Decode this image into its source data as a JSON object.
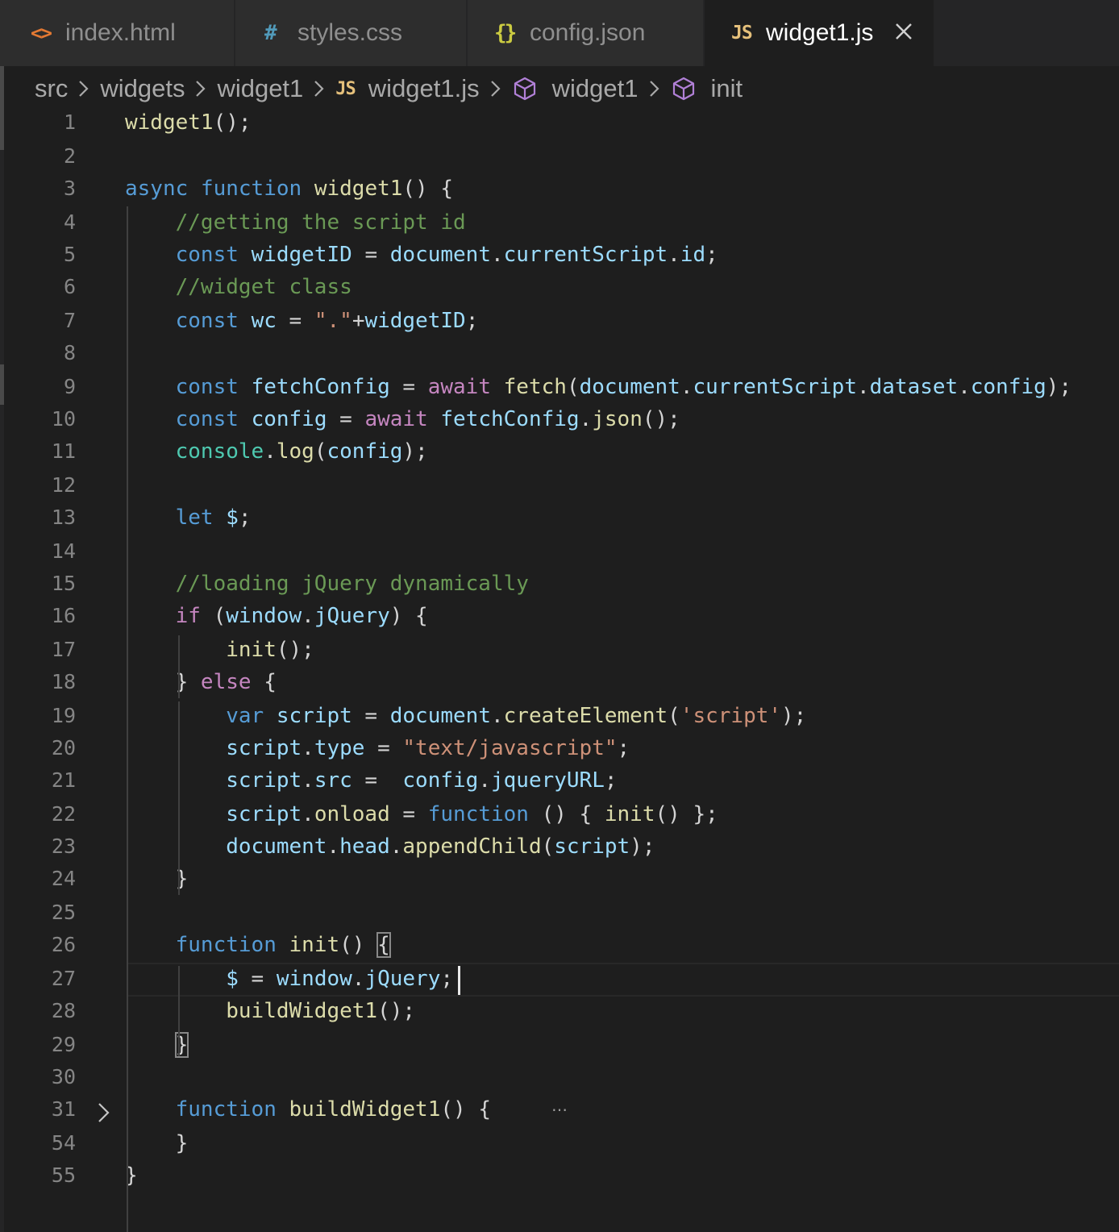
{
  "tabs": [
    {
      "icon": "<>",
      "label": "index.html",
      "active": false
    },
    {
      "icon": "#",
      "label": "styles.css",
      "active": false
    },
    {
      "icon": "{}",
      "label": "config.json",
      "active": false
    },
    {
      "icon": "JS",
      "label": "widget1.js",
      "active": true
    }
  ],
  "breadcrumb": {
    "items": [
      "src",
      "widgets",
      "widget1",
      "widget1.js",
      "widget1",
      "init"
    ],
    "file_icon": "JS"
  },
  "icons": {
    "html": "html-brackets-icon",
    "css": "css-hash-icon",
    "json": "json-braces-icon",
    "js": "javascript-icon",
    "close": "close-icon",
    "chevron": "chevron-right-icon",
    "symbol": "cube-symbol-icon",
    "fold": "fold-chevron-icon"
  },
  "colors": {
    "background": "#1e1e1e",
    "tab_inactive": "#2d2d2d",
    "keyword": "#569cd6",
    "control": "#c586c0",
    "function": "#dcdcaa",
    "variable": "#9cdcfe",
    "string": "#ce9178",
    "comment": "#6a9955",
    "class": "#4ec9b0",
    "line_number": "#858585",
    "html_icon": "#e37933",
    "css_icon": "#519aba",
    "json_icon": "#cbcb41",
    "js_icon": "#e5c07b",
    "symbol_icon": "#b180d7"
  },
  "editor": {
    "lines": [
      {
        "n": "1",
        "tokens": [
          [
            "fn",
            "widget1"
          ],
          [
            "pun",
            "();"
          ]
        ]
      },
      {
        "n": "2",
        "tokens": []
      },
      {
        "n": "3",
        "tokens": [
          [
            "kw",
            "async"
          ],
          [
            "pun",
            " "
          ],
          [
            "kw",
            "function"
          ],
          [
            "pun",
            " "
          ],
          [
            "fn",
            "widget1"
          ],
          [
            "pun",
            "() {"
          ]
        ]
      },
      {
        "n": "4",
        "tokens": [
          [
            "pun",
            "    "
          ],
          [
            "cmt",
            "//getting the script id"
          ]
        ]
      },
      {
        "n": "5",
        "tokens": [
          [
            "pun",
            "    "
          ],
          [
            "kw",
            "const"
          ],
          [
            "pun",
            " "
          ],
          [
            "var",
            "widgetID"
          ],
          [
            "pun",
            " = "
          ],
          [
            "var",
            "document"
          ],
          [
            "pun",
            "."
          ],
          [
            "var",
            "currentScript"
          ],
          [
            "pun",
            "."
          ],
          [
            "var",
            "id"
          ],
          [
            "pun",
            ";"
          ]
        ]
      },
      {
        "n": "6",
        "tokens": [
          [
            "pun",
            "    "
          ],
          [
            "cmt",
            "//widget class"
          ]
        ]
      },
      {
        "n": "7",
        "tokens": [
          [
            "pun",
            "    "
          ],
          [
            "kw",
            "const"
          ],
          [
            "pun",
            " "
          ],
          [
            "var",
            "wc"
          ],
          [
            "pun",
            " = "
          ],
          [
            "str",
            "\".\""
          ],
          [
            "pun",
            "+"
          ],
          [
            "var",
            "widgetID"
          ],
          [
            "pun",
            ";"
          ]
        ]
      },
      {
        "n": "8",
        "tokens": []
      },
      {
        "n": "9",
        "tokens": [
          [
            "pun",
            "    "
          ],
          [
            "kw",
            "const"
          ],
          [
            "pun",
            " "
          ],
          [
            "var",
            "fetchConfig"
          ],
          [
            "pun",
            " = "
          ],
          [
            "ctl",
            "await"
          ],
          [
            "pun",
            " "
          ],
          [
            "fn",
            "fetch"
          ],
          [
            "pun",
            "("
          ],
          [
            "var",
            "document"
          ],
          [
            "pun",
            "."
          ],
          [
            "var",
            "currentScript"
          ],
          [
            "pun",
            "."
          ],
          [
            "var",
            "dataset"
          ],
          [
            "pun",
            "."
          ],
          [
            "var",
            "config"
          ],
          [
            "pun",
            ");"
          ]
        ]
      },
      {
        "n": "10",
        "tokens": [
          [
            "pun",
            "    "
          ],
          [
            "kw",
            "const"
          ],
          [
            "pun",
            " "
          ],
          [
            "var",
            "config"
          ],
          [
            "pun",
            " = "
          ],
          [
            "ctl",
            "await"
          ],
          [
            "pun",
            " "
          ],
          [
            "var",
            "fetchConfig"
          ],
          [
            "pun",
            "."
          ],
          [
            "fn",
            "json"
          ],
          [
            "pun",
            "();"
          ]
        ]
      },
      {
        "n": "11",
        "tokens": [
          [
            "pun",
            "    "
          ],
          [
            "cls",
            "console"
          ],
          [
            "pun",
            "."
          ],
          [
            "fn",
            "log"
          ],
          [
            "pun",
            "("
          ],
          [
            "var",
            "config"
          ],
          [
            "pun",
            ");"
          ]
        ]
      },
      {
        "n": "12",
        "tokens": []
      },
      {
        "n": "13",
        "tokens": [
          [
            "pun",
            "    "
          ],
          [
            "kw",
            "let"
          ],
          [
            "pun",
            " "
          ],
          [
            "var",
            "$"
          ],
          [
            "pun",
            ";"
          ]
        ]
      },
      {
        "n": "14",
        "tokens": []
      },
      {
        "n": "15",
        "tokens": [
          [
            "pun",
            "    "
          ],
          [
            "cmt",
            "//loading jQuery dynamically"
          ]
        ]
      },
      {
        "n": "16",
        "tokens": [
          [
            "pun",
            "    "
          ],
          [
            "ctl",
            "if"
          ],
          [
            "pun",
            " ("
          ],
          [
            "var",
            "window"
          ],
          [
            "pun",
            "."
          ],
          [
            "var",
            "jQuery"
          ],
          [
            "pun",
            ") {"
          ]
        ]
      },
      {
        "n": "17",
        "tokens": [
          [
            "pun",
            "        "
          ],
          [
            "fn",
            "init"
          ],
          [
            "pun",
            "();"
          ]
        ]
      },
      {
        "n": "18",
        "tokens": [
          [
            "pun",
            "    } "
          ],
          [
            "ctl",
            "else"
          ],
          [
            "pun",
            " {"
          ]
        ]
      },
      {
        "n": "19",
        "tokens": [
          [
            "pun",
            "        "
          ],
          [
            "kw",
            "var"
          ],
          [
            "pun",
            " "
          ],
          [
            "var",
            "script"
          ],
          [
            "pun",
            " = "
          ],
          [
            "var",
            "document"
          ],
          [
            "pun",
            "."
          ],
          [
            "fn",
            "createElement"
          ],
          [
            "pun",
            "("
          ],
          [
            "str",
            "'script'"
          ],
          [
            "pun",
            ");"
          ]
        ]
      },
      {
        "n": "20",
        "tokens": [
          [
            "pun",
            "        "
          ],
          [
            "var",
            "script"
          ],
          [
            "pun",
            "."
          ],
          [
            "var",
            "type"
          ],
          [
            "pun",
            " = "
          ],
          [
            "str",
            "\"text/javascript\""
          ],
          [
            "pun",
            ";"
          ]
        ]
      },
      {
        "n": "21",
        "tokens": [
          [
            "pun",
            "        "
          ],
          [
            "var",
            "script"
          ],
          [
            "pun",
            "."
          ],
          [
            "var",
            "src"
          ],
          [
            "pun",
            " =  "
          ],
          [
            "var",
            "config"
          ],
          [
            "pun",
            "."
          ],
          [
            "var",
            "jqueryURL"
          ],
          [
            "pun",
            ";"
          ]
        ]
      },
      {
        "n": "22",
        "tokens": [
          [
            "pun",
            "        "
          ],
          [
            "var",
            "script"
          ],
          [
            "pun",
            "."
          ],
          [
            "fn",
            "onload"
          ],
          [
            "pun",
            " = "
          ],
          [
            "kw",
            "function"
          ],
          [
            "pun",
            " () { "
          ],
          [
            "fn",
            "init"
          ],
          [
            "pun",
            "() };"
          ]
        ]
      },
      {
        "n": "23",
        "tokens": [
          [
            "pun",
            "        "
          ],
          [
            "var",
            "document"
          ],
          [
            "pun",
            "."
          ],
          [
            "var",
            "head"
          ],
          [
            "pun",
            "."
          ],
          [
            "fn",
            "appendChild"
          ],
          [
            "pun",
            "("
          ],
          [
            "var",
            "script"
          ],
          [
            "pun",
            ");"
          ]
        ]
      },
      {
        "n": "24",
        "tokens": [
          [
            "pun",
            "    }"
          ]
        ]
      },
      {
        "n": "25",
        "tokens": []
      },
      {
        "n": "26",
        "tokens": [
          [
            "pun",
            "    "
          ],
          [
            "kw",
            "function"
          ],
          [
            "pun",
            " "
          ],
          [
            "fn",
            "init"
          ],
          [
            "pun",
            "() "
          ],
          [
            "bm",
            "{"
          ]
        ]
      },
      {
        "n": "27",
        "tokens": [
          [
            "pun",
            "        "
          ],
          [
            "var",
            "$"
          ],
          [
            "pun",
            " = "
          ],
          [
            "var",
            "window"
          ],
          [
            "pun",
            "."
          ],
          [
            "var",
            "jQuery"
          ],
          [
            "pun",
            ";"
          ]
        ]
      },
      {
        "n": "28",
        "tokens": [
          [
            "pun",
            "        "
          ],
          [
            "fn",
            "buildWidget1"
          ],
          [
            "pun",
            "();"
          ]
        ]
      },
      {
        "n": "29",
        "tokens": [
          [
            "pun",
            "    "
          ],
          [
            "bm",
            "}"
          ]
        ]
      },
      {
        "n": "30",
        "tokens": []
      },
      {
        "n": "31",
        "tokens": [
          [
            "pun",
            "    "
          ],
          [
            "kw",
            "function"
          ],
          [
            "pun",
            " "
          ],
          [
            "fn",
            "buildWidget1"
          ],
          [
            "pun",
            "() {"
          ]
        ]
      },
      {
        "n": "54",
        "tokens": [
          [
            "pun",
            "    }"
          ]
        ]
      },
      {
        "n": "55",
        "tokens": [
          [
            "pun",
            "}"
          ]
        ]
      }
    ],
    "folded_placeholder": "⋯"
  }
}
